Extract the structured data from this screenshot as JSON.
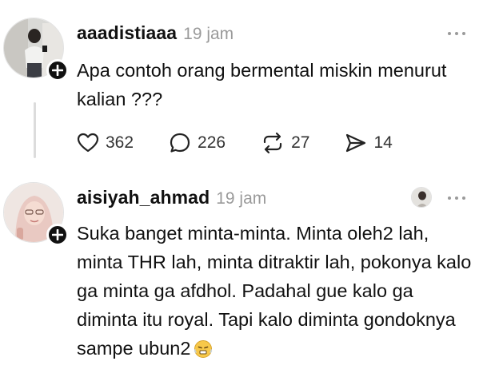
{
  "posts": [
    {
      "username": "aaadistiaaa",
      "time": "19 jam",
      "text": "Apa contoh orang bermental miskin menurut kalian ???",
      "stats": {
        "likes": "362",
        "replies": "226",
        "reposts": "27",
        "shares": "14"
      },
      "avatar_icon": "user-photo-avatar",
      "badge_icon": "plus-icon"
    },
    {
      "username": "aisiyah_ahmad",
      "time": "19 jam",
      "text": "Suka banget minta-minta. Minta oleh2 lah, minta THR lah, minta ditraktir lah, pokonya kalo ga minta ga afdhol. Padahal gue kalo ga diminta itu royal. Tapi kalo diminta gondoknya sampe ubun2",
      "emoji": "😤",
      "avatar_icon": "user-photo-avatar",
      "badge_icon": "plus-icon",
      "liked_by_icon": "liked-by-author-avatar"
    }
  ],
  "colors": {
    "text": "#111111",
    "muted": "#9a9a9a",
    "badge": "#111111",
    "thread_line": "#dcdcdc"
  }
}
